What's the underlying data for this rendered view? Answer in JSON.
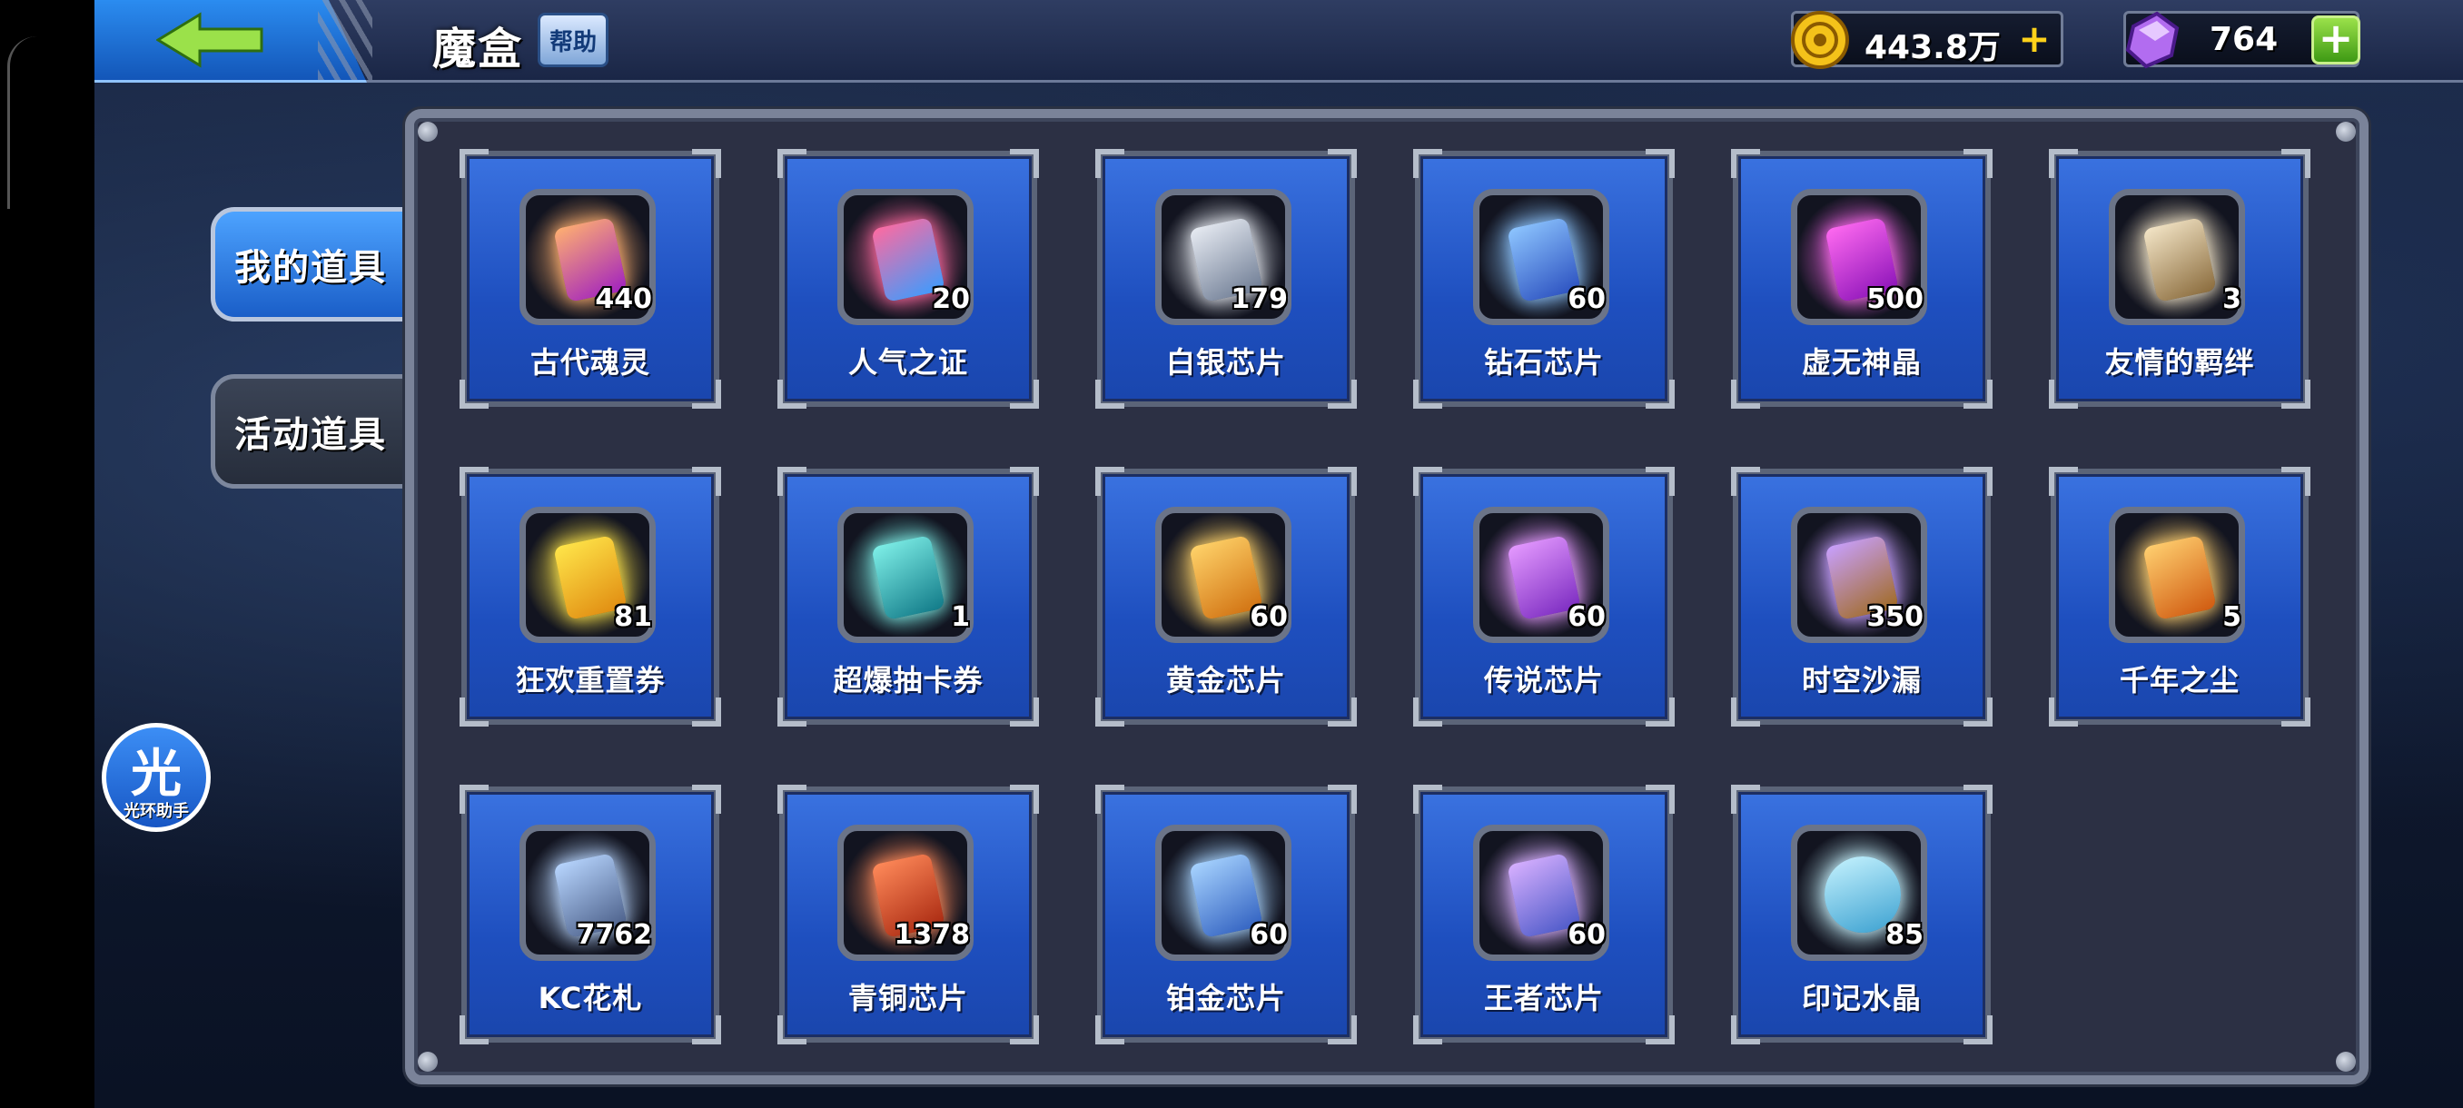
{
  "header": {
    "title": "魔盒",
    "help_label": "帮助",
    "gold": "443.8万",
    "gems": "764"
  },
  "tabs": [
    {
      "label": "我的道具",
      "active": true
    },
    {
      "label": "活动道具",
      "active": false
    }
  ],
  "assistant": {
    "glyph": "光",
    "label": "光环助手"
  },
  "items": [
    {
      "name": "古代魂灵",
      "count": "440"
    },
    {
      "name": "人气之证",
      "count": "20"
    },
    {
      "name": "白银芯片",
      "count": "179"
    },
    {
      "name": "钻石芯片",
      "count": "60"
    },
    {
      "name": "虚无神晶",
      "count": "500"
    },
    {
      "name": "友情的羁绊",
      "count": "3"
    },
    {
      "name": "狂欢重置券",
      "count": "81"
    },
    {
      "name": "超爆抽卡券",
      "count": "1"
    },
    {
      "name": "黄金芯片",
      "count": "60"
    },
    {
      "name": "传说芯片",
      "count": "60"
    },
    {
      "name": "时空沙漏",
      "count": "350"
    },
    {
      "name": "千年之尘",
      "count": "5"
    },
    {
      "name": "KC花札",
      "count": "7762"
    },
    {
      "name": "青铜芯片",
      "count": "1378"
    },
    {
      "name": "铂金芯片",
      "count": "60"
    },
    {
      "name": "王者芯片",
      "count": "60"
    },
    {
      "name": "印记水晶",
      "count": "85"
    }
  ],
  "colors": {
    "accent_blue": "#2b8cf0",
    "back_arrow": "#9be14a",
    "gold_plus": "#ffd21a",
    "item_colors": [
      [
        "#ffb070",
        "#a020c0"
      ],
      [
        "#ff6aa0",
        "#3a9cff"
      ],
      [
        "#e8ecf3",
        "#6d7b93"
      ],
      [
        "#8ec6ff",
        "#2a4fbf"
      ],
      [
        "#ff6af0",
        "#8a12b8"
      ],
      [
        "#f4e6c8",
        "#8a6b3c"
      ],
      [
        "#ffe64a",
        "#e08a10"
      ],
      [
        "#7ff0e8",
        "#117a88"
      ],
      [
        "#ffd36a",
        "#d07010"
      ],
      [
        "#e59aff",
        "#7a2ac0"
      ],
      [
        "#c8a0ff",
        "#a06a20"
      ],
      [
        "#ffd070",
        "#d05a10"
      ],
      [
        "#b8d6ff",
        "#4a5e88"
      ],
      [
        "#ff8a5a",
        "#a82810"
      ],
      [
        "#a8d4ff",
        "#3060c0"
      ],
      [
        "#d8b0ff",
        "#4a58c8"
      ],
      [
        "#c8f4ff",
        "#3aa0d0"
      ]
    ]
  }
}
